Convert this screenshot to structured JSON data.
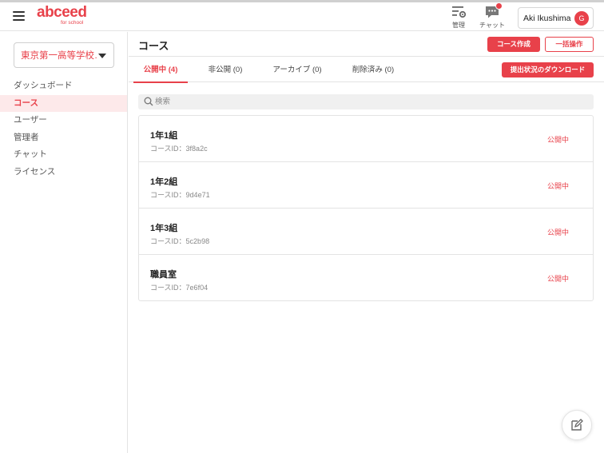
{
  "header": {
    "logo": "abceed",
    "logo_sub": "for school",
    "admin_label": "管理",
    "chat_label": "チャット",
    "user_name": "Aki Ikushima",
    "avatar_initial": "G"
  },
  "sidebar": {
    "school": "東京第一高等学校…",
    "items": [
      {
        "label": "ダッシュボード",
        "active": false
      },
      {
        "label": "コース",
        "active": true
      },
      {
        "label": "ユーザー",
        "active": false
      },
      {
        "label": "管理者",
        "active": false
      },
      {
        "label": "チャット",
        "active": false
      },
      {
        "label": "ライセンス",
        "active": false
      }
    ]
  },
  "main": {
    "title": "コース",
    "create_button": "コース作成",
    "bulk_button": "一括操作",
    "download_button": "提出状況のダウンロード",
    "tabs": [
      {
        "label": "公開中 (4)",
        "active": true
      },
      {
        "label": "非公開 (0)",
        "active": false
      },
      {
        "label": "アーカイブ (0)",
        "active": false
      },
      {
        "label": "削除済み (0)",
        "active": false
      }
    ],
    "search_placeholder": "検索",
    "courses": [
      {
        "name": "1年1組",
        "id": "コースID：3f8a2c",
        "status": "公開中"
      },
      {
        "name": "1年2組",
        "id": "コースID：9d4e71",
        "status": "公開中"
      },
      {
        "name": "1年3組",
        "id": "コースID：5c2b98",
        "status": "公開中"
      },
      {
        "name": "職員室",
        "id": "コースID：7e6f04",
        "status": "公開中"
      }
    ]
  },
  "colors": {
    "accent": "#e8414a",
    "active_bg": "#fde9ea"
  }
}
